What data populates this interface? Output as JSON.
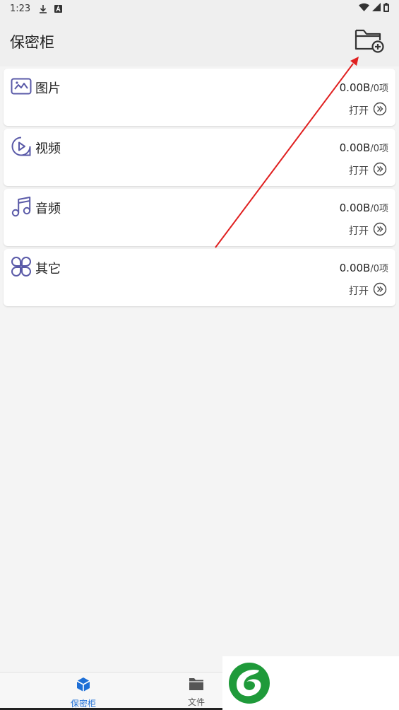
{
  "status_bar": {
    "time": "1:23",
    "icons": [
      "download-icon",
      "a-icon",
      "wifi-icon",
      "signal-icon",
      "battery-icon"
    ]
  },
  "app_bar": {
    "title": "保密柜",
    "action_icon": "add-folder-icon"
  },
  "categories": [
    {
      "name": "图片",
      "icon": "image-icon",
      "size": "0.00B",
      "count": "/0项",
      "open_label": "打开"
    },
    {
      "name": "视频",
      "icon": "video-icon",
      "size": "0.00B",
      "count": "/0项",
      "open_label": "打开"
    },
    {
      "name": "音频",
      "icon": "music-icon",
      "size": "0.00B",
      "count": "/0项",
      "open_label": "打开"
    },
    {
      "name": "其它",
      "icon": "other-icon",
      "size": "0.00B",
      "count": "/0项",
      "open_label": "打开"
    }
  ],
  "bottom_nav": {
    "items": [
      {
        "label": "保密柜",
        "icon": "vault-icon",
        "active": true
      },
      {
        "label": "文件",
        "icon": "folder-icon",
        "active": false
      }
    ]
  },
  "colors": {
    "accent": "#1e6fd6",
    "icon": "#5a5aa8",
    "annotation": "#e02020",
    "logo": "#1f9a3a"
  }
}
